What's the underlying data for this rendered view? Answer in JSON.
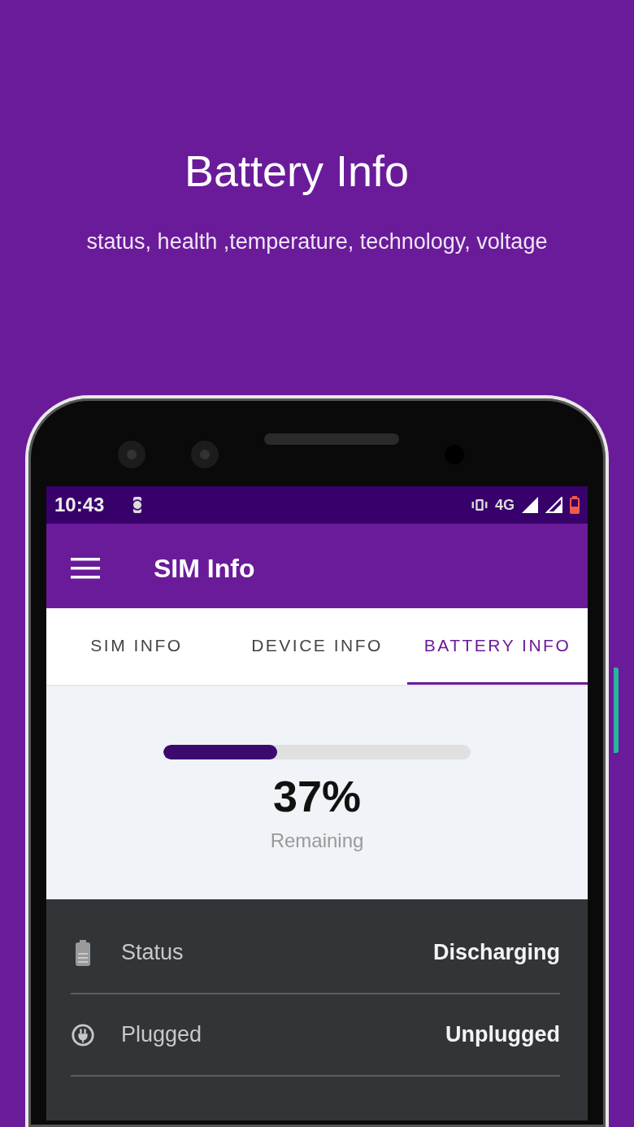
{
  "title": "Battery Info",
  "subtitle": "status, health ,temperature, technology, voltage",
  "status_bar": {
    "time": "10:43",
    "network": "4G"
  },
  "app_bar": {
    "title": "SIM Info"
  },
  "tabs": [
    {
      "label": "SIM INFO",
      "selected": false
    },
    {
      "label": "DEVICE INFO",
      "selected": false
    },
    {
      "label": "BATTERY INFO",
      "selected": true
    }
  ],
  "battery": {
    "level": 0.37,
    "percent": "37%",
    "caption": "Remaining"
  },
  "rows": [
    {
      "kind": "status",
      "label": "Status",
      "value": "Discharging"
    },
    {
      "kind": "plugged",
      "label": "Plugged",
      "value": "Unplugged"
    }
  ]
}
